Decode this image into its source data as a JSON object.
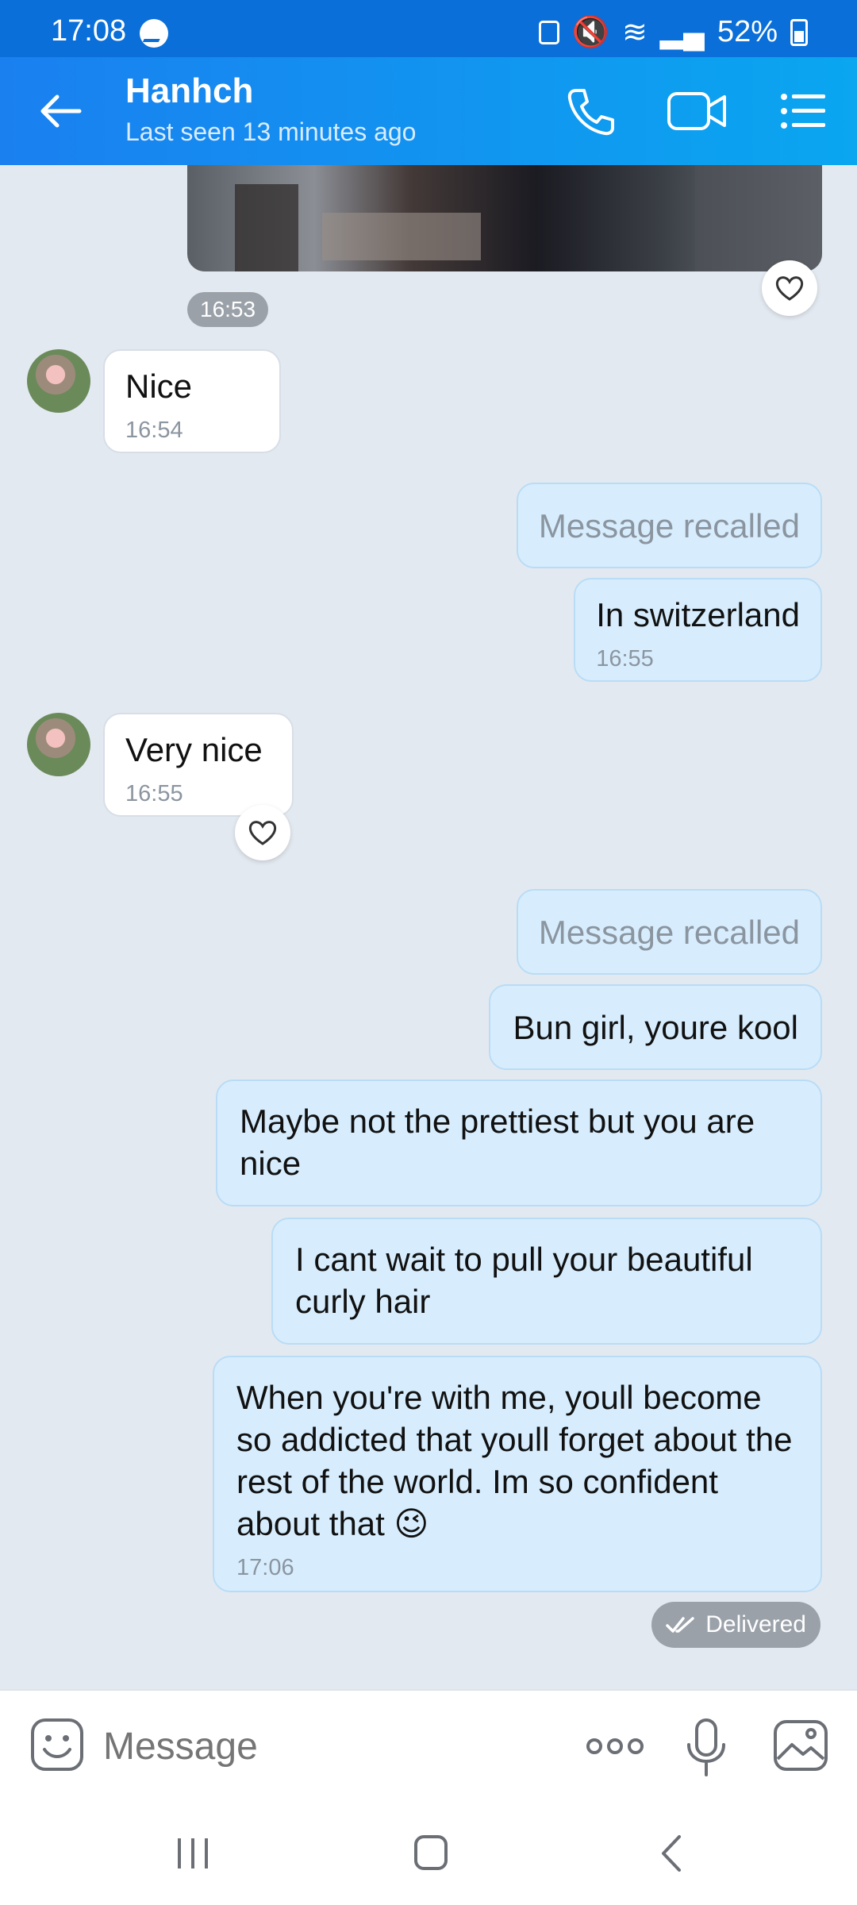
{
  "status_bar": {
    "time": "17:08",
    "battery": "52%"
  },
  "header": {
    "title": "Hanhch",
    "subtitle": "Last seen 13 minutes ago"
  },
  "chat": {
    "photo_time": "16:53",
    "messages": [
      {
        "from": "them",
        "text": "Nice",
        "time": "16:54"
      },
      {
        "from": "me",
        "text": "Message recalled",
        "recalled": true
      },
      {
        "from": "me",
        "text": "In switzerland",
        "time": "16:55"
      },
      {
        "from": "them",
        "text": "Very nice",
        "time": "16:55"
      },
      {
        "from": "me",
        "text": "Message recalled",
        "recalled": true
      },
      {
        "from": "me",
        "text": "Bun girl, youre kool"
      },
      {
        "from": "me",
        "text": "Maybe not the prettiest but you are nice"
      },
      {
        "from": "me",
        "text": "I cant wait to pull your beautiful curly hair"
      },
      {
        "from": "me",
        "text": "When you're with me, youll become so addicted that youll forget about the rest of the world. Im so confident about that 😉",
        "time": "17:06"
      }
    ],
    "delivered_label": "Delivered"
  },
  "composer": {
    "placeholder": "Message"
  },
  "colors": {
    "header_start": "#1a80f0",
    "header_end": "#0aa6f0",
    "outgoing_bubble": "#d7edfd",
    "chat_bg": "#e3e9f0"
  },
  "icons": [
    "back-arrow-icon",
    "phone-icon",
    "video-icon",
    "menu-icon",
    "heart-icon",
    "emoji-icon",
    "more-icon",
    "mic-icon",
    "gallery-icon"
  ]
}
